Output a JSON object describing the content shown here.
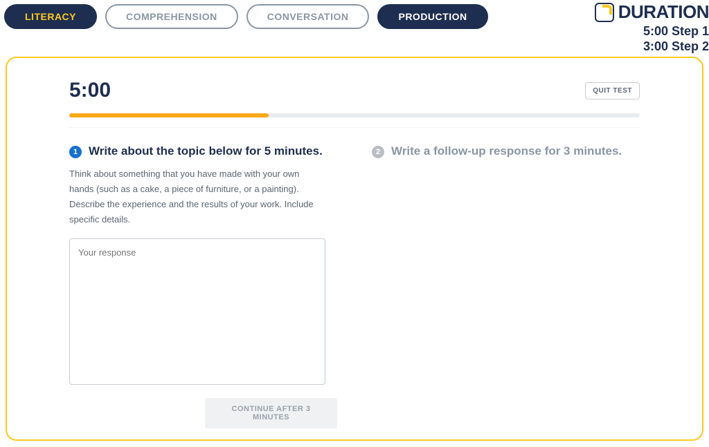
{
  "tabs": {
    "literacy": "LITERACY",
    "comprehension": "COMPREHENSION",
    "conversation": "CONVERSATION",
    "production": "PRODUCTION"
  },
  "duration": {
    "label": "DURATION",
    "line1": "5:00 Step 1",
    "line2": "3:00 Step 2"
  },
  "timer": "5:00",
  "quit_label": "QUIT TEST",
  "progress": {
    "percent": 35
  },
  "step1": {
    "badge": "1",
    "title": "Write about the topic below for 5 minutes.",
    "desc": "Think about something that you have made with your own hands (such as a cake, a piece of furniture, or a painting). Describe the experience and the results of your work. Include specific details.",
    "placeholder": "Your response"
  },
  "step2": {
    "badge": "2",
    "title": "Write a follow-up response for 3 minutes."
  },
  "continue_label": "CONTINUE AFTER 3 MINUTES"
}
